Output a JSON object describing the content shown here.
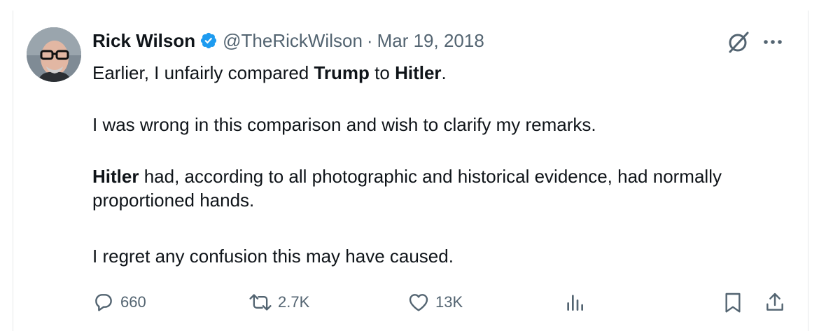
{
  "tweet": {
    "author_name": "Rick Wilson",
    "handle": "@TheRickWilson",
    "separator": "·",
    "date": "Mar 19, 2018",
    "line1_a": "Earlier, I unfairly compared ",
    "line1_trump": "Trump",
    "line1_b": " to ",
    "line1_hitler": "Hitler",
    "line1_c": ".",
    "line2": "I was wrong in this comparison and wish to clarify my remarks.",
    "line3_hitler": "Hitler",
    "line3_rest": " had, according to all photographic and historical evidence, had normally proportioned hands.",
    "line4": "I regret any confusion this may have caused."
  },
  "actions": {
    "replies": "660",
    "reposts": "2.7K",
    "likes": "13K"
  },
  "icons": {
    "verified": "verified-badge-icon",
    "grok": "grok-icon",
    "more": "more-icon",
    "reply": "reply-icon",
    "repost": "repost-icon",
    "like": "heart-icon",
    "views": "views-icon",
    "bookmark": "bookmark-icon",
    "share": "share-icon"
  },
  "colors": {
    "text": "#0f1419",
    "secondary": "#536471",
    "verified": "#1d9bf0",
    "border": "#e7e9ea"
  }
}
